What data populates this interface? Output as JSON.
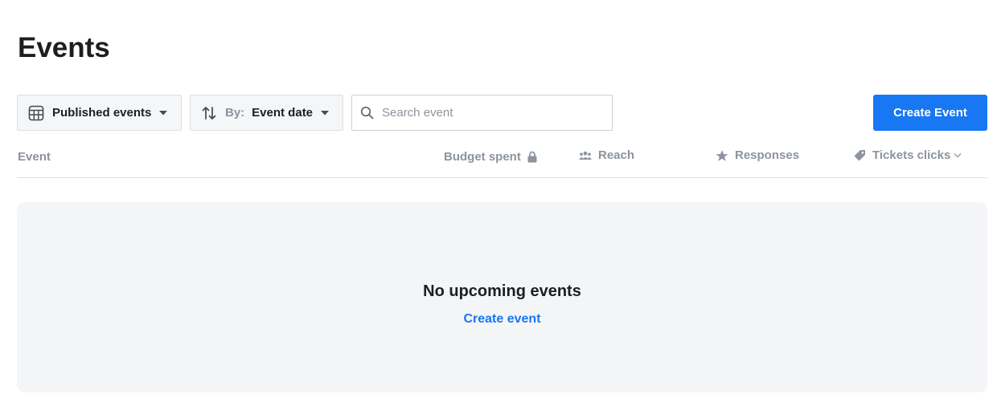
{
  "page": {
    "title": "Events"
  },
  "toolbar": {
    "published_filter_label": "Published events",
    "sort_prefix": "By:",
    "sort_value": "Event date",
    "search_placeholder": "Search event",
    "create_button_label": "Create Event"
  },
  "table": {
    "columns": {
      "event": "Event",
      "budget": "Budget spent",
      "reach": "Reach",
      "responses": "Responses",
      "tickets": "Tickets clicks"
    }
  },
  "empty_state": {
    "title": "No upcoming events",
    "link_label": "Create event"
  },
  "colors": {
    "accent": "#1877f2",
    "muted_text": "#8d949e",
    "panel_bg": "#f4f5f7"
  }
}
